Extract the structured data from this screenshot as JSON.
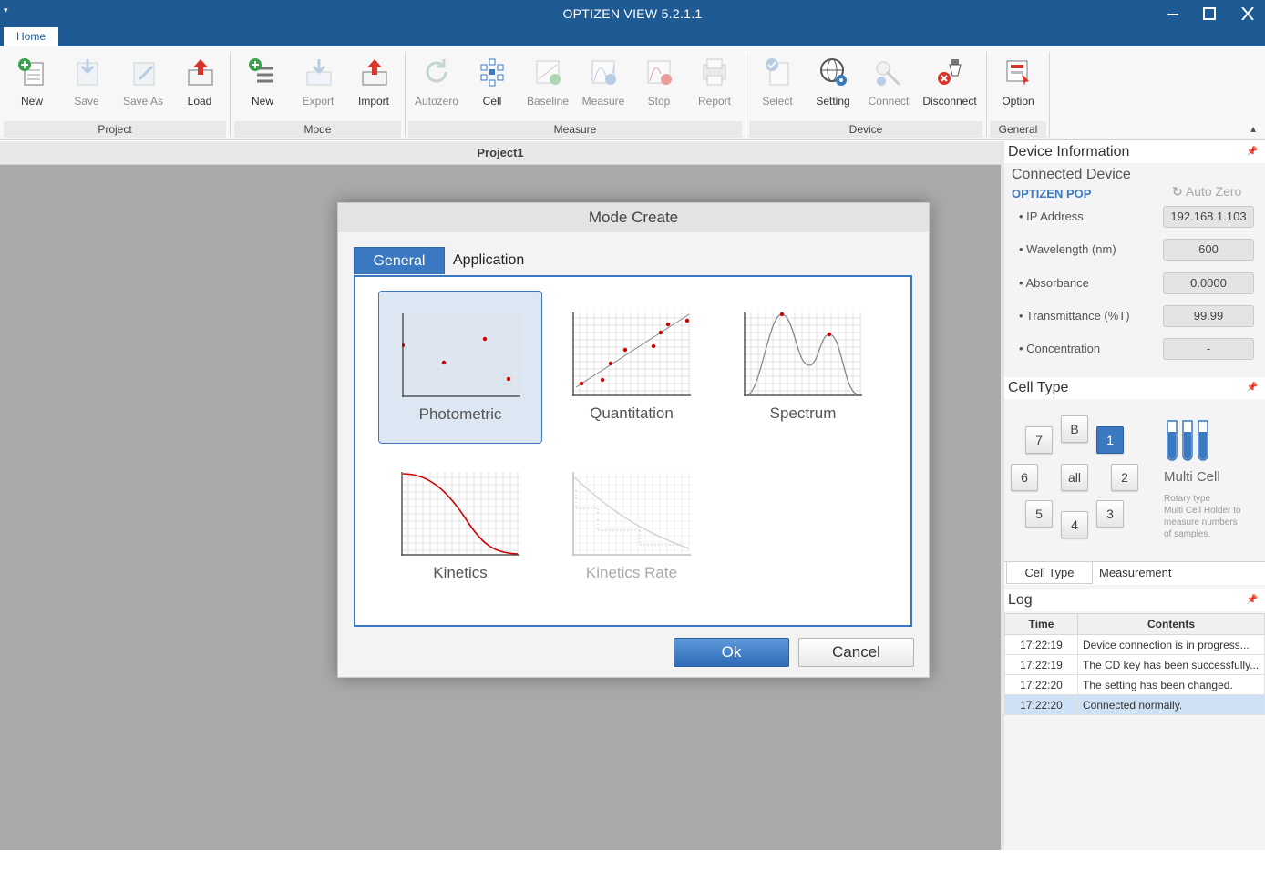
{
  "app": {
    "title": "OPTIZEN VIEW 5.2.1.1"
  },
  "ribbon": {
    "tab": "Home",
    "groups": {
      "project": {
        "label": "Project",
        "buttons": {
          "new": "New",
          "save": "Save",
          "save_as": "Save As",
          "load": "Load"
        }
      },
      "mode": {
        "label": "Mode",
        "buttons": {
          "new": "New",
          "export": "Export",
          "import": "Import"
        }
      },
      "measure": {
        "label": "Measure",
        "buttons": {
          "autozero": "Autozero",
          "cell": "Cell",
          "baseline": "Baseline",
          "measure": "Measure",
          "stop": "Stop",
          "report": "Report"
        }
      },
      "device": {
        "label": "Device",
        "buttons": {
          "select": "Select",
          "setting": "Setting",
          "connect": "Connect",
          "disconnect": "Disconnect"
        }
      },
      "general": {
        "label": "General",
        "buttons": {
          "option": "Option"
        }
      }
    }
  },
  "document": {
    "tab_title": "Project1"
  },
  "dialog": {
    "title": "Mode Create",
    "tabs": {
      "general": "General",
      "application": "Application"
    },
    "modes": {
      "photometric": "Photometric",
      "quantitation": "Quantitation",
      "spectrum": "Spectrum",
      "kinetics": "Kinetics",
      "kinetics_rate": "Kinetics Rate"
    },
    "selected_mode": "Photometric",
    "buttons": {
      "ok": "Ok",
      "cancel": "Cancel"
    }
  },
  "device_info": {
    "header": "Device Information",
    "connected_label": "Connected Device",
    "device_name": "OPTIZEN POP",
    "auto_zero": "Auto Zero",
    "fields": {
      "ip": {
        "label": "• IP Address",
        "value": "192.168.1.103"
      },
      "wavelength": {
        "label": "• Wavelength (nm)",
        "value": "600"
      },
      "absorbance": {
        "label": "• Absorbance",
        "value": "0.0000"
      },
      "transmittance": {
        "label": "• Transmittance (%T)",
        "value": "99.99"
      },
      "concentration": {
        "label": "• Concentration",
        "value": "-"
      }
    }
  },
  "cell_type": {
    "header": "Cell Type",
    "buttons": {
      "c7": "7",
      "cB": "B",
      "c1": "1",
      "c6": "6",
      "call": "all",
      "c2": "2",
      "c5": "5",
      "c4": "4",
      "c3": "3"
    },
    "active": "1",
    "holder_title": "Multi Cell",
    "holder_desc_1": "Rotary type",
    "holder_desc_2": "Multi Cell Holder to",
    "holder_desc_3": "measure numbers",
    "holder_desc_4": "of samples.",
    "subtabs": {
      "cell_type": "Cell Type",
      "measurement": "Measurement"
    }
  },
  "log": {
    "header": "Log",
    "columns": {
      "time": "Time",
      "contents": "Contents"
    },
    "rows": [
      {
        "time": "17:22:19",
        "contents": "Device connection is in progress..."
      },
      {
        "time": "17:22:19",
        "contents": "The CD key has been successfully..."
      },
      {
        "time": "17:22:20",
        "contents": "The setting has been changed."
      },
      {
        "time": "17:22:20",
        "contents": "Connected normally."
      }
    ]
  },
  "colors": {
    "titlebar": "#1e5a94",
    "accent": "#3a78c2",
    "workspace": "#aaaaaa",
    "plot_point": "#cc0000"
  }
}
